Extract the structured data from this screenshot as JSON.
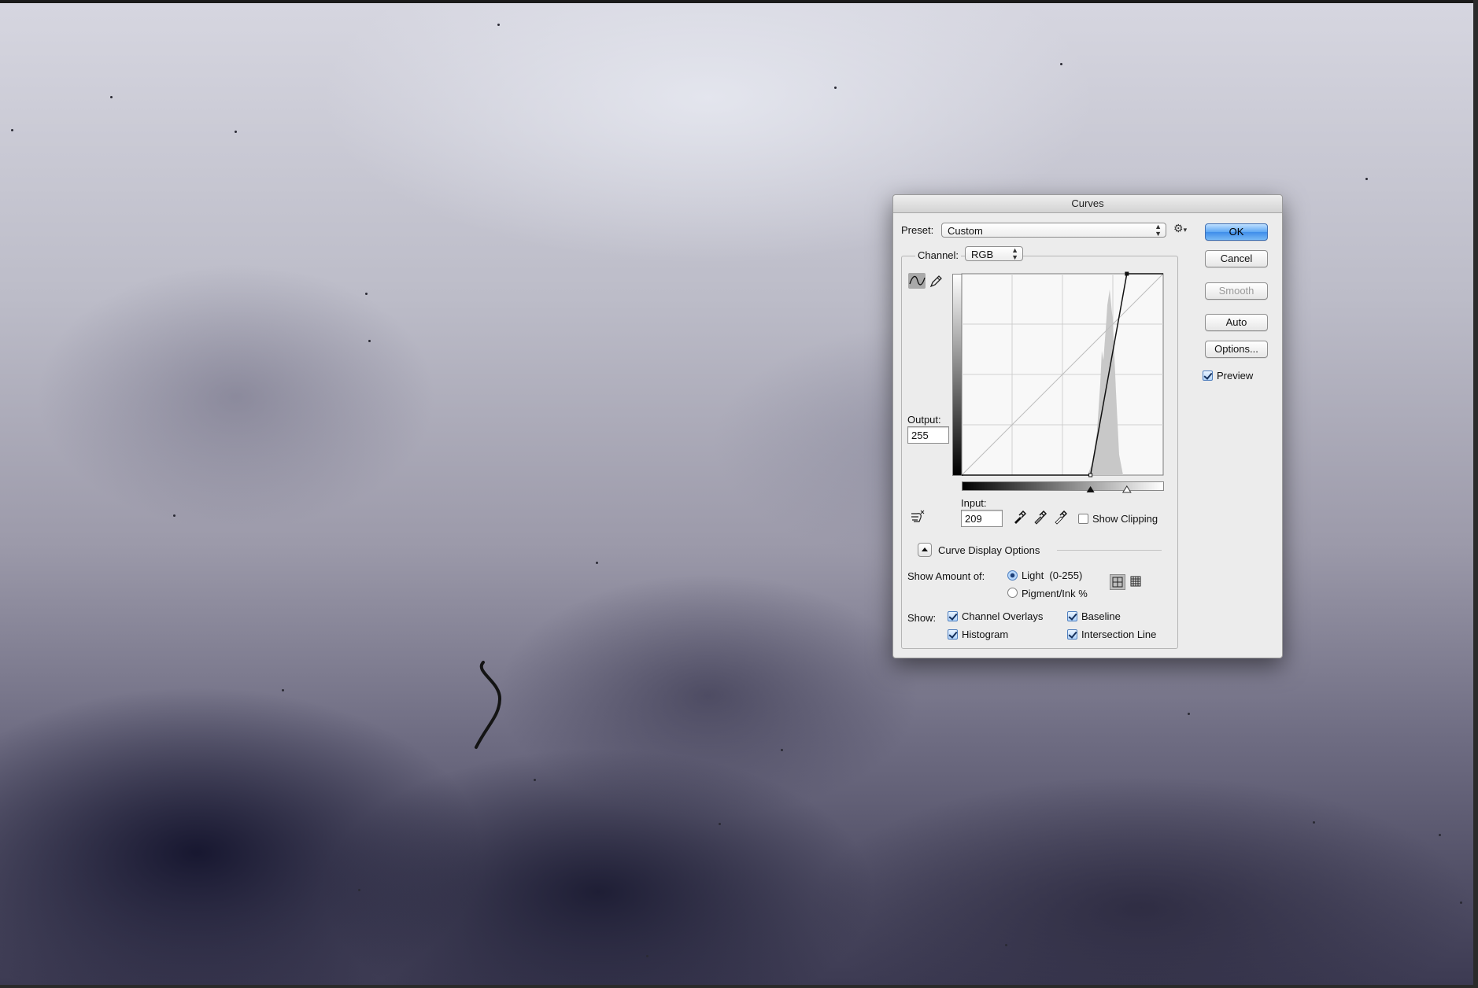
{
  "dialog": {
    "title": "Curves",
    "preset_label": "Preset:",
    "preset_value": "Custom",
    "channel_label": "Channel:",
    "channel_value": "RGB",
    "output_label": "Output:",
    "output_value": "255",
    "input_label": "Input:",
    "input_value": "209",
    "show_clipping_label": "Show Clipping",
    "show_clipping_checked": false,
    "curve_display_options_label": "Curve Display Options",
    "show_amount_label": "Show Amount of:",
    "light_option_label": "Light  (0-255)",
    "pigment_option_label": "Pigment/Ink %",
    "light_selected": true,
    "show_label": "Show:",
    "show_options": {
      "channel_overlays": {
        "label": "Channel Overlays",
        "checked": true
      },
      "baseline": {
        "label": "Baseline",
        "checked": true
      },
      "histogram": {
        "label": "Histogram",
        "checked": true
      },
      "intersection_line": {
        "label": "Intersection Line",
        "checked": true
      }
    },
    "buttons": {
      "ok": "OK",
      "cancel": "Cancel",
      "smooth": "Smooth",
      "auto": "Auto",
      "options": "Options..."
    },
    "preview_label": "Preview",
    "preview_checked": true,
    "curve_points": [
      [
        0,
        0
      ],
      [
        163,
        0
      ],
      [
        209,
        255
      ],
      [
        255,
        255
      ]
    ],
    "input_black_slider": 163,
    "input_white_slider": 209
  },
  "icons": {
    "preset_gear": "gear-icon",
    "curve_tool": "curve-point-tool-icon",
    "pencil_tool": "pencil-icon",
    "target_adjust": "hand-target-icon",
    "eyedroppers": [
      "black-eyedropper-icon",
      "gray-eyedropper-icon",
      "white-eyedropper-icon"
    ]
  }
}
